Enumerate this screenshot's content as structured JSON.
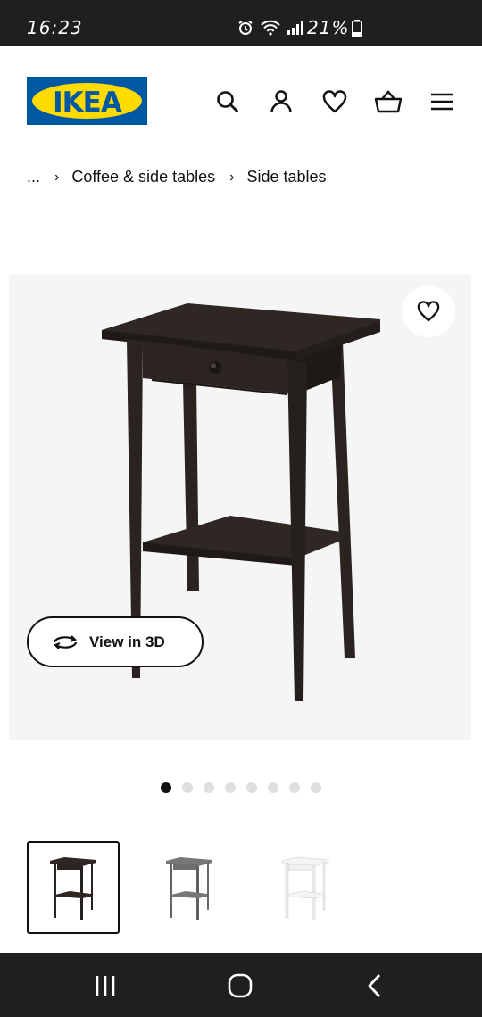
{
  "status_bar": {
    "time": "16:23",
    "battery_percent": "21%"
  },
  "header": {
    "logo_text": "IKEA",
    "icons": [
      "search-icon",
      "account-icon",
      "heart-icon",
      "basket-icon",
      "menu-icon"
    ]
  },
  "breadcrumb": {
    "ellipsis": "...",
    "items": [
      "Coffee & side tables",
      "Side tables"
    ]
  },
  "product": {
    "view_3d_label": "View in 3D",
    "carousel": {
      "total_slides": 8,
      "active_index": 0
    },
    "color_variants": [
      "black-brown",
      "dark grey",
      "white"
    ],
    "selected_variant_index": 0
  },
  "colors": {
    "ikea_blue": "#0058a3",
    "ikea_yellow": "#ffdb00",
    "variant_black_brown": "#2e2724",
    "variant_dark_grey": "#6e6e6e",
    "variant_white": "#f2f2f2"
  }
}
